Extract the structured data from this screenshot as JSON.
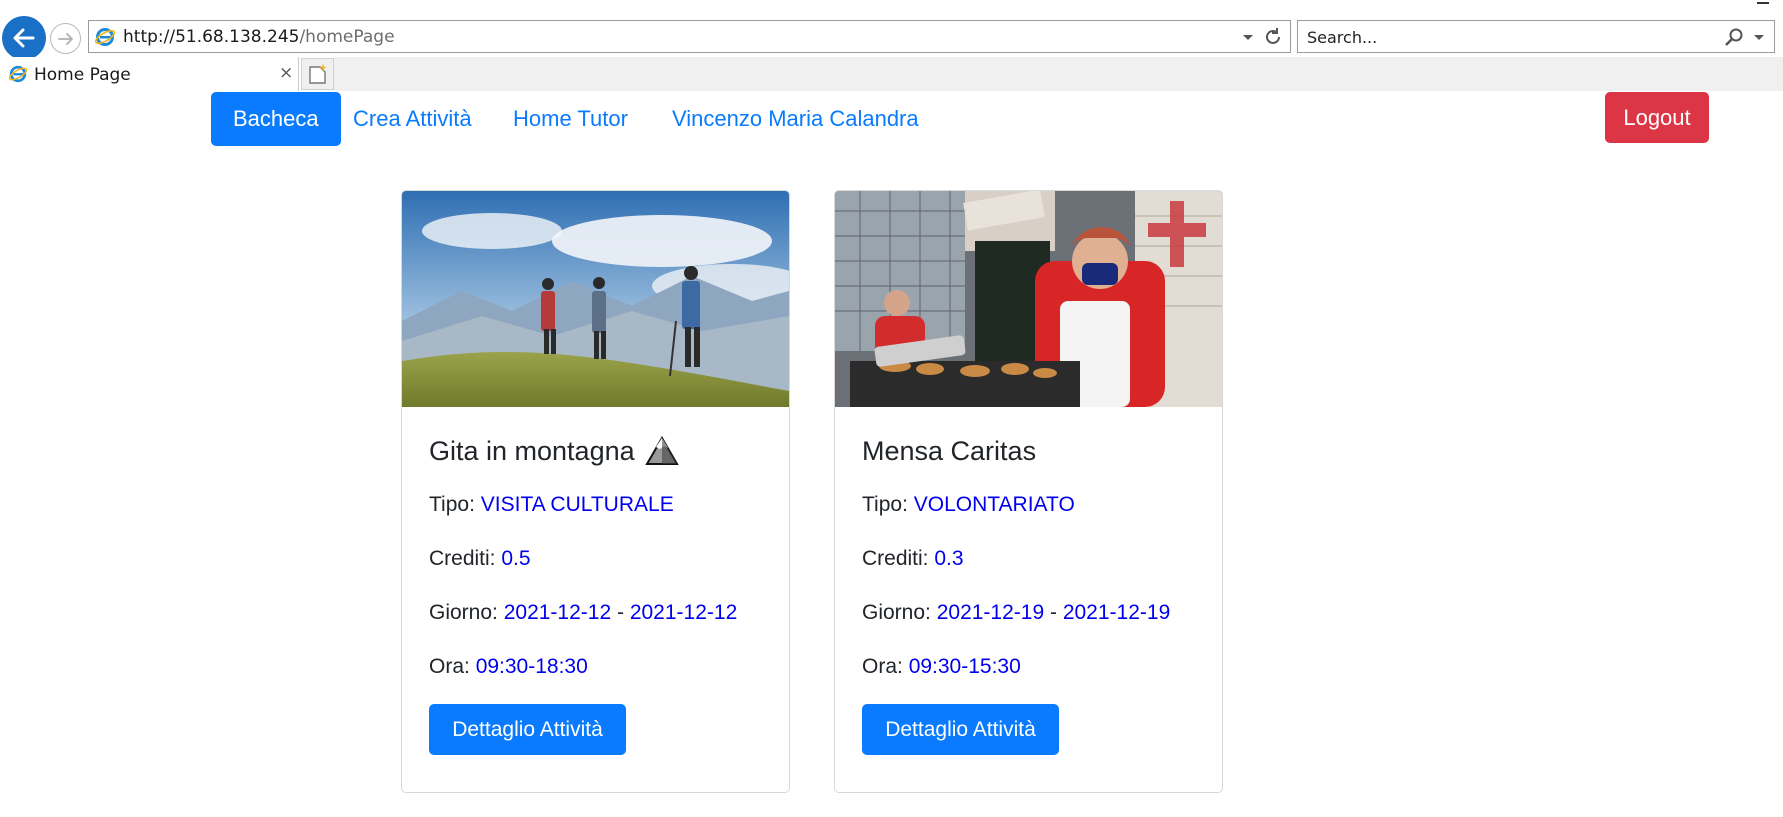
{
  "browser": {
    "url_host": "http://51.68.138.245",
    "url_path": "/homePage",
    "search_placeholder": "Search...",
    "tab_title": "Home Page",
    "tab_close": "×"
  },
  "nav": {
    "items": [
      {
        "label": "Bacheca",
        "active": true
      },
      {
        "label": "Crea Attività",
        "active": false
      },
      {
        "label": "Home Tutor",
        "active": false
      },
      {
        "label": "Vincenzo Maria Calandra",
        "active": false
      }
    ],
    "logout_label": "Logout"
  },
  "labels": {
    "tipo": "Tipo:",
    "crediti": "Crediti:",
    "giorno": "Giorno:",
    "ora": "Ora:",
    "date_separator": "-"
  },
  "cards": [
    {
      "title": "Gita in montagna",
      "tipo": "VISITA CULTURALE",
      "crediti": "0.5",
      "giorno_start": "2021-12-12",
      "giorno_end": "2021-12-12",
      "ora": "09:30-18:30",
      "button_label": "Dettaglio Attività"
    },
    {
      "title": "Mensa Caritas",
      "tipo": "VOLONTARIATO",
      "crediti": "0.3",
      "giorno_start": "2021-12-19",
      "giorno_end": "2021-12-19",
      "ora": "09:30-15:30",
      "button_label": "Dettaglio Attività"
    }
  ],
  "colors": {
    "primary": "#0a7bff",
    "danger": "#dc3545",
    "value_link": "#0000ee"
  }
}
